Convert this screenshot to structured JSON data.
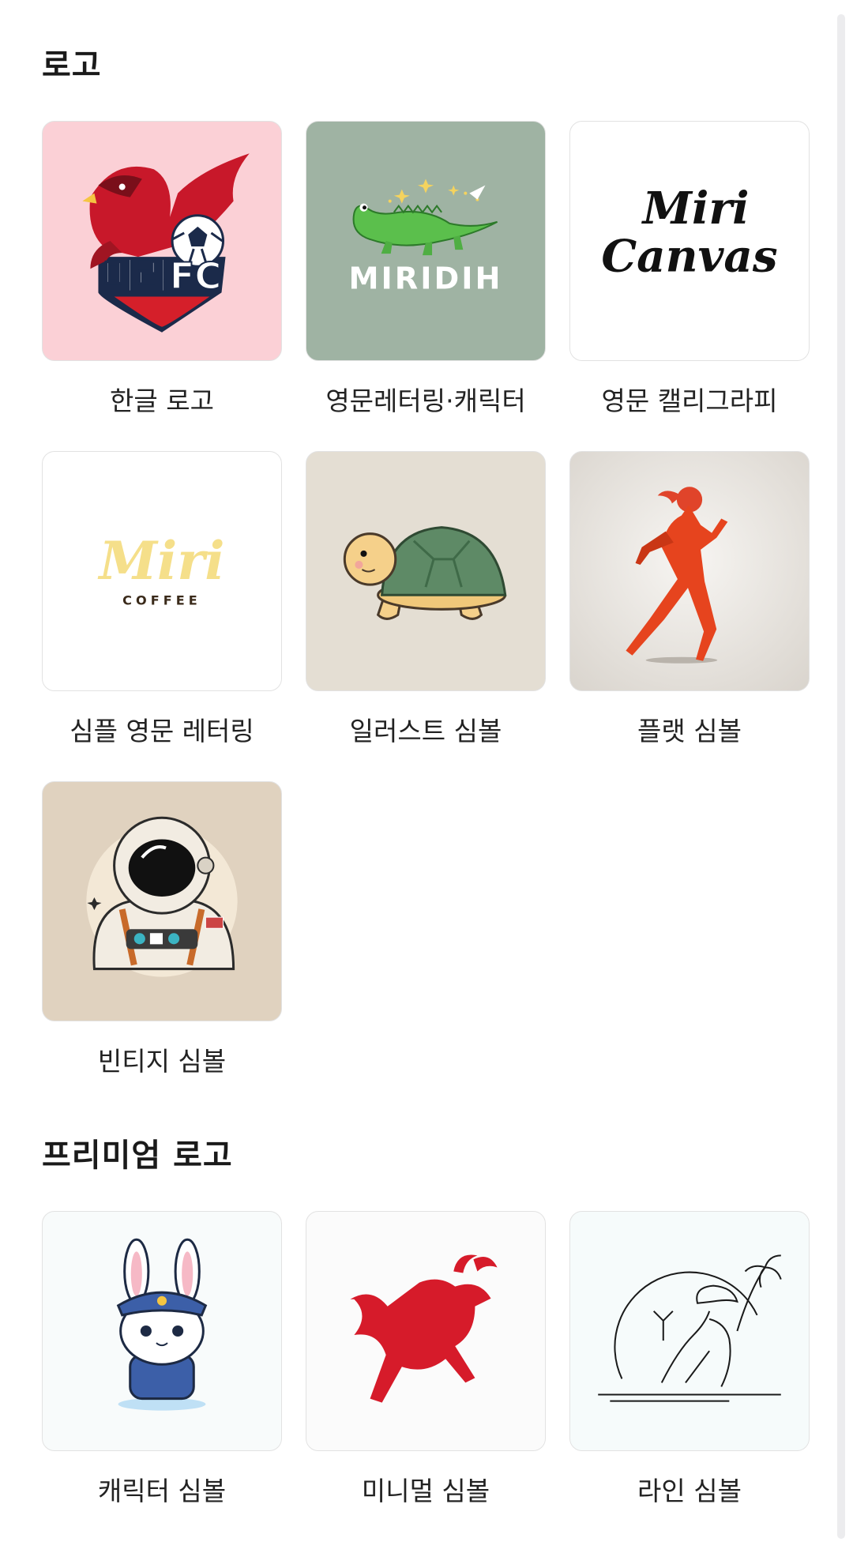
{
  "sections": [
    {
      "title": "로고",
      "items": [
        {
          "label": "한글 로고",
          "art_text": "미리FC",
          "bg": "#fbd0d6"
        },
        {
          "label": "영문레터링·캐릭터",
          "art_text": "MIRIDIH",
          "bg": "#9fb3a3"
        },
        {
          "label": "영문 캘리그라피",
          "art_text_1": "Miri",
          "art_text_2": "Canvas",
          "bg": "#ffffff"
        },
        {
          "label": "심플 영문 레터링",
          "art_text_1": "Miri",
          "art_text_2": "COFFEE",
          "bg": "#ffffff"
        },
        {
          "label": "일러스트 심볼",
          "bg": "#e4ded3"
        },
        {
          "label": "플랫 심볼",
          "bg": "#e3e0dc"
        },
        {
          "label": "빈티지 심볼",
          "bg": "#e0d2bf"
        }
      ]
    },
    {
      "title": "프리미엄 로고",
      "items": [
        {
          "label": "캐릭터 심볼",
          "bg": "#f8fbfb"
        },
        {
          "label": "미니멀 심볼",
          "bg": "#fbfbfb"
        },
        {
          "label": "라인 심볼",
          "bg": "#f6fbfb"
        }
      ]
    }
  ]
}
